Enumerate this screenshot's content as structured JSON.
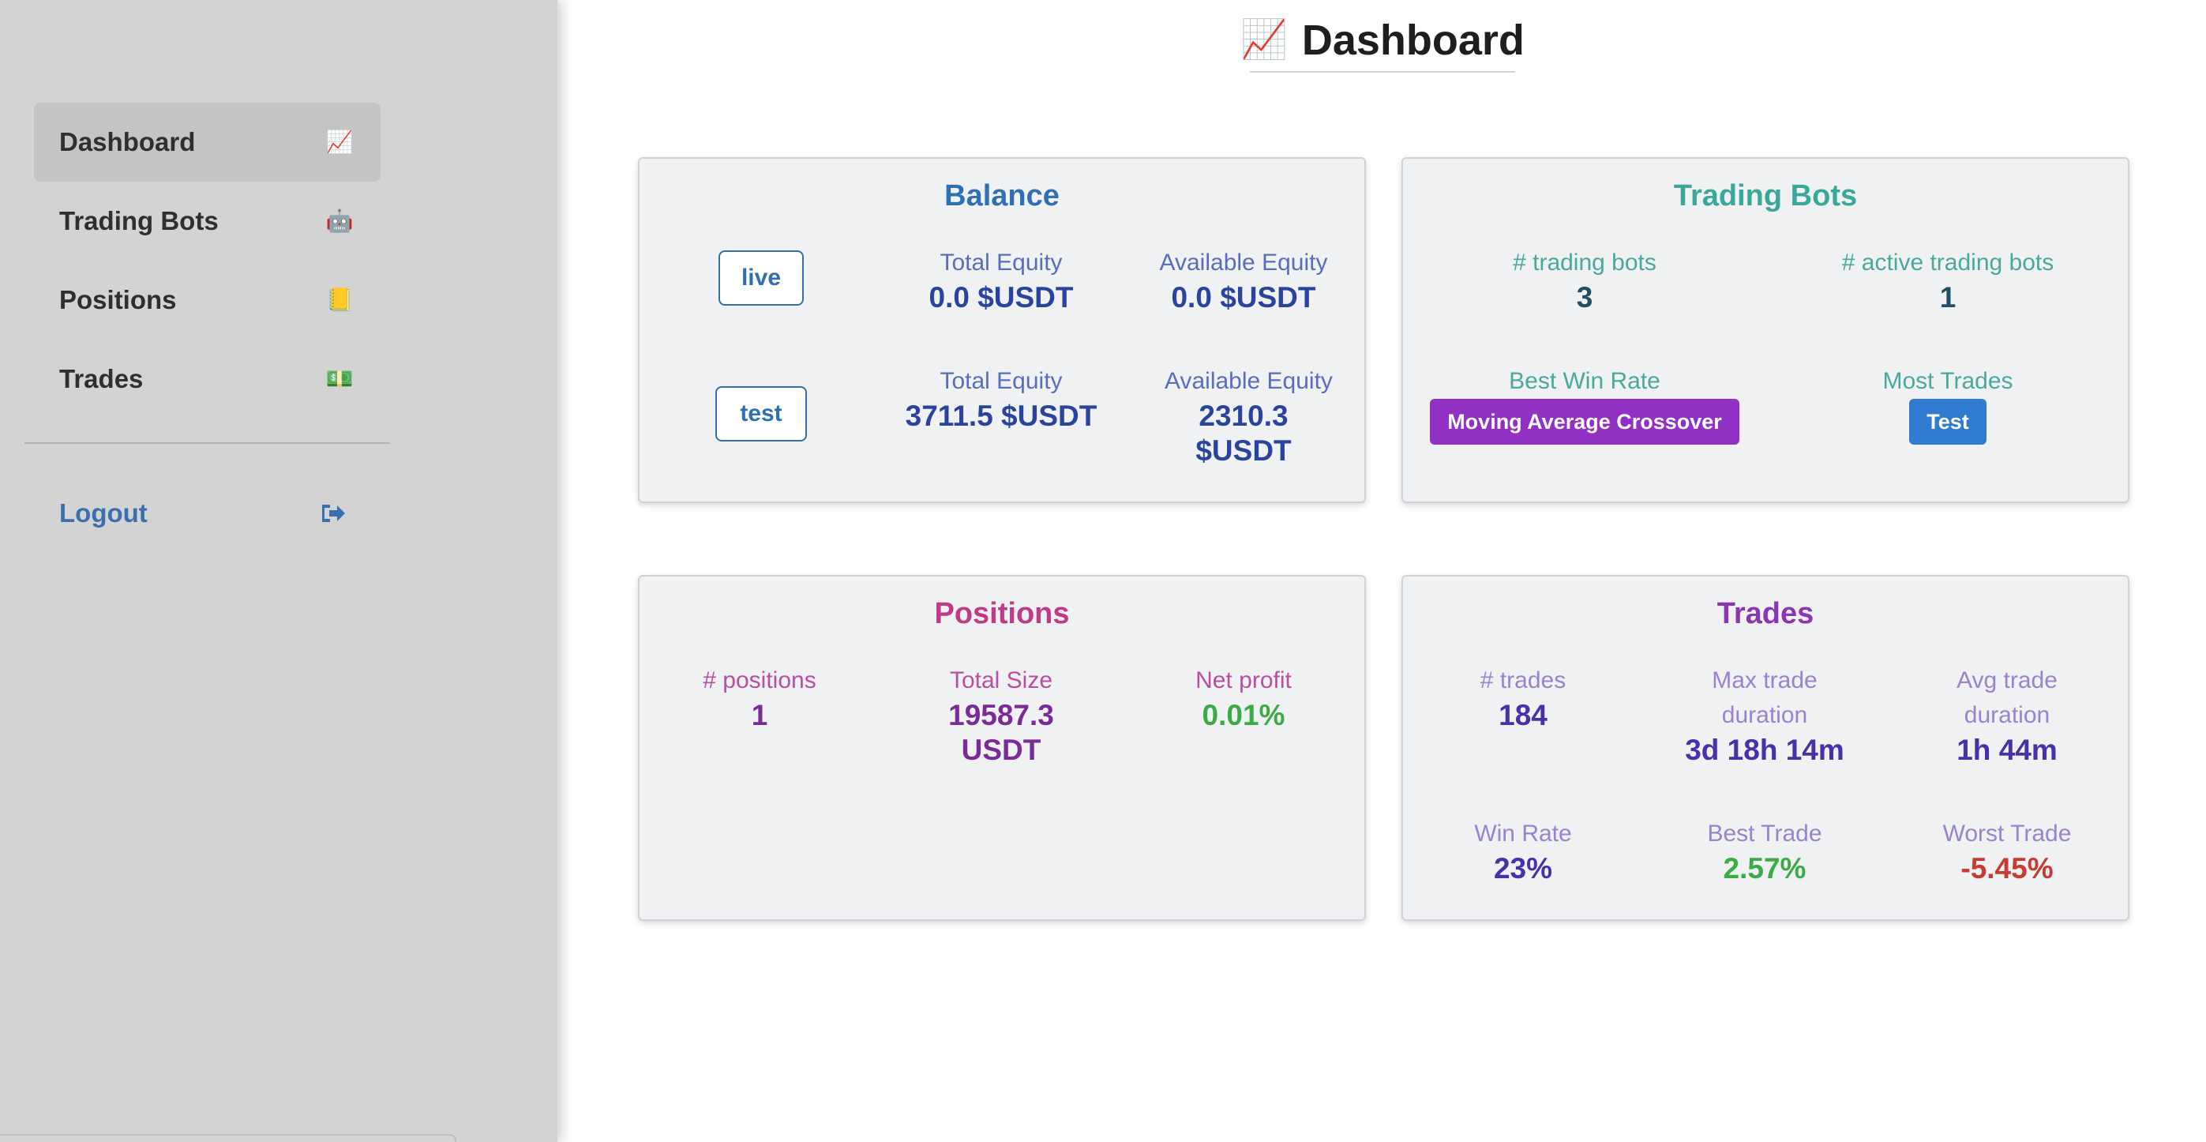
{
  "sidebar": {
    "items": [
      {
        "label": "Dashboard",
        "icon": "chart-increasing-icon",
        "glyph": "📈",
        "active": true
      },
      {
        "label": "Trading Bots",
        "icon": "robot-icon",
        "glyph": "🤖",
        "active": false
      },
      {
        "label": "Positions",
        "icon": "ledger-icon",
        "glyph": "📒",
        "active": false
      },
      {
        "label": "Trades",
        "icon": "money-icon",
        "glyph": "💵",
        "active": false
      }
    ],
    "logout": {
      "label": "Logout",
      "icon": "sign-out-icon",
      "glyph": "➜"
    }
  },
  "header": {
    "title": "Dashboard",
    "icon_glyph": "📈"
  },
  "balance": {
    "title": "Balance",
    "rows": [
      {
        "mode": "live",
        "total_equity_label": "Total Equity",
        "total_equity_value": "0.0 $USDT",
        "available_equity_label": "Available Equity",
        "available_equity_value": "0.0 $USDT"
      },
      {
        "mode": "test",
        "total_equity_label": "Total Equity",
        "total_equity_value": "3711.5 $USDT",
        "available_equity_label": "Available Equity",
        "available_equity_value": "2310.3 $USDT"
      }
    ]
  },
  "trading_bots": {
    "title": "Trading Bots",
    "count_label": "# trading bots",
    "count_value": "3",
    "active_label": "# active trading bots",
    "active_value": "1",
    "best_win_rate_label": "Best Win Rate",
    "best_win_rate_value": "Moving Average Crossover",
    "most_trades_label": "Most Trades",
    "most_trades_value": "Test"
  },
  "positions": {
    "title": "Positions",
    "count_label": "# positions",
    "count_value": "1",
    "total_size_label": "Total Size",
    "total_size_value": "19587.3 USDT",
    "net_profit_label": "Net profit",
    "net_profit_value": "0.01%"
  },
  "trades": {
    "title": "Trades",
    "count_label": "# trades",
    "count_value": "184",
    "max_duration_label": "Max trade duration",
    "max_duration_value": "3d 18h 14m",
    "avg_duration_label": "Avg trade duration",
    "avg_duration_value": "1h 44m",
    "win_rate_label": "Win Rate",
    "win_rate_value": "23%",
    "best_trade_label": "Best Trade",
    "best_trade_value": "2.57%",
    "worst_trade_label": "Worst Trade",
    "worst_trade_value": "-5.45%"
  },
  "colors": {
    "sidebar_bg": "#d3d3d3",
    "balance_accent": "#2f6fb3",
    "bots_accent": "#3aa79b",
    "positions_accent": "#c13a86",
    "trades_accent": "#8b35b5",
    "positive": "#3caa45",
    "negative": "#c63b32"
  }
}
